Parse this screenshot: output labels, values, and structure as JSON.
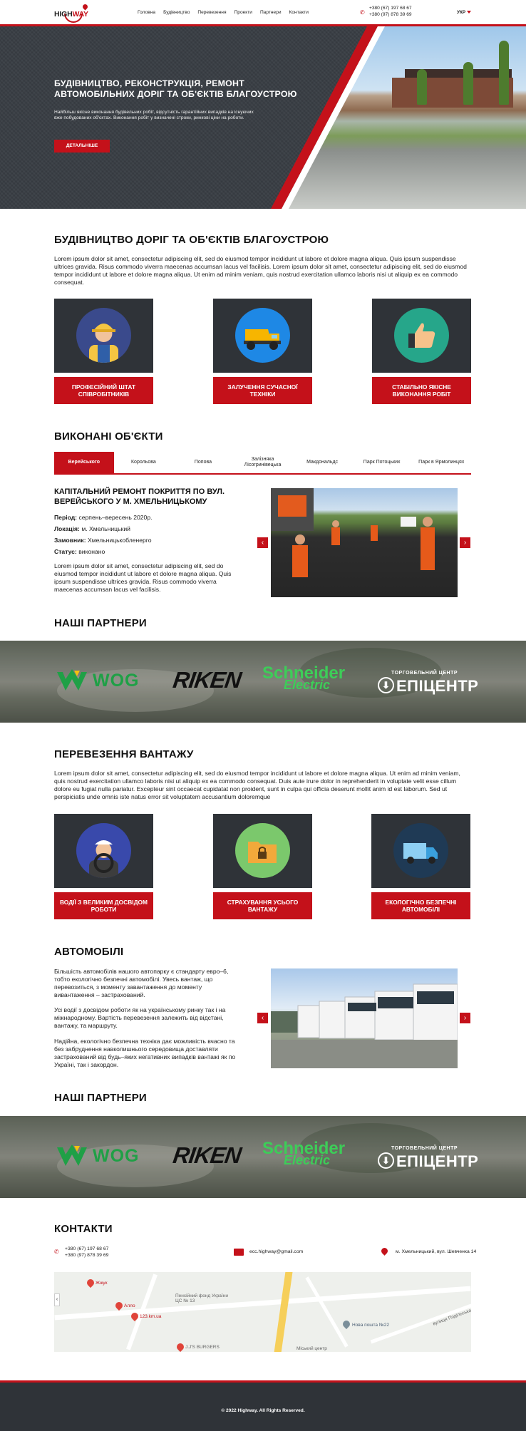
{
  "header": {
    "logo_text_a": "HIGH",
    "logo_text_b": "WAY",
    "nav": [
      "Головна",
      "Будівництво",
      "Перевезення",
      "Проекти",
      "Партнери",
      "Контакти"
    ],
    "phones": [
      "+380 (67) 197 68 67",
      "+380 (97) 878 39 69"
    ],
    "lang": "УКР",
    "brand_color": "#c4111a"
  },
  "hero": {
    "title": "БУДІВНИЦТВО, РЕКОНСТРУКЦІЯ, РЕМОНТ АВТОМОБІЛЬНИХ ДОРІГ ТА ОБ'ЄКТІВ БЛАГОУСТРОЮ",
    "subtitle": "Найбільш якісне виконання будівельних робіт, відсутність гарантійних випадків на існуючих вже побудованих об'єктах. Виконання робіт у визначені строки, ринкові ціни на роботи.",
    "button": "ДЕТАЛЬНІШЕ"
  },
  "construction": {
    "title": "БУДІВНИЦТВО ДОРІГ ТА ОБ'ЄКТІВ БЛАГОУСТРОЮ",
    "text": "Lorem ipsum dolor sit amet, consectetur adipiscing elit, sed do eiusmod tempor incididunt ut labore et dolore magna aliqua. Quis ipsum suspendisse ultrices gravida. Risus commodo viverra maecenas accumsan lacus vel facilisis. Lorem ipsum dolor sit amet, consectetur adipiscing elit, sed do eiusmod tempor incididunt ut labore et dolore magna aliqua. Ut enim ad minim veniam, quis nostrud exercitation ullamco laboris nisi ut aliquip ex ea commodo consequat.",
    "cards": [
      {
        "label": "ПРОФЕСІЙНИЙ ШТАТ СПІВРОБІТНИКІВ",
        "icon": "worker-icon"
      },
      {
        "label": "ЗАЛУЧЕННЯ СУЧАСНОЇ ТЕХНІКИ",
        "icon": "dump-truck-icon"
      },
      {
        "label": "СТАБІЛЬНО ЯКІСНЕ ВИКОНАННЯ РОБІТ",
        "icon": "thumbs-up-icon"
      }
    ]
  },
  "projects": {
    "title": "ВИКОНАНІ ОБ'ЄКТИ",
    "tabs": [
      "Верейського",
      "Корольова",
      "Попова",
      "Залізняка Лісогринівецька",
      "Макдональдс",
      "Парк Потоцьких",
      "Парк в Ярмолинцях"
    ],
    "active_tab": "Верейського",
    "item": {
      "title": "КАПІТАЛЬНИЙ РЕМОНТ ПОКРИТТЯ ПО ВУЛ. ВЕРЕЙСЬКОГО У М. ХМЕЛЬНИЦЬКОМУ",
      "period_label": "Період:",
      "period": "серпень–вересень 2020р.",
      "location_label": "Локація:",
      "location": "м. Хмельницький",
      "client_label": "Замовник:",
      "client": "Хмельницькобленерго",
      "status_label": "Статус:",
      "status": "виконано",
      "text": "Lorem ipsum dolor sit amet, consectetur adipiscing elit, sed do eiusmod tempor incididunt ut labore et dolore magna aliqua. Quis ipsum suspendisse ultrices gravida. Risus commodo viverra maecenas accumsan lacus vel facilisis."
    }
  },
  "partners": {
    "title": "НАШІ ПАРТНЕРИ",
    "logos": {
      "wog": "WOG",
      "riken": "RIKEN",
      "schneider_a": "Schneider",
      "schneider_b": "Electric",
      "epic_top": "ТОРГОВЕЛЬНИЙ ЦЕНТР",
      "epic_main": "ЕПІЦЕНТР"
    }
  },
  "transport": {
    "title": "ПЕРЕВЕЗЕННЯ ВАНТАЖУ",
    "text": "Lorem ipsum dolor sit amet, consectetur adipiscing elit, sed do eiusmod tempor incididunt ut labore et dolore magna aliqua. Ut enim ad minim veniam, quis nostrud exercitation ullamco laboris nisi ut aliquip ex ea commodo consequat. Duis aute irure dolor in reprehenderit in voluptate velit esse cillum dolore eu fugiat nulla pariatur. Excepteur sint occaecat cupidatat non proident, sunt in culpa qui officia deserunt mollit anim id est laborum. Sed ut perspiciatis unde omnis iste natus error sit voluptatem accusantium doloremque",
    "cards": [
      {
        "label": "ВОДІЇ З ВЕЛИКИМ ДОСВІДОМ РОБОТИ",
        "icon": "driver-icon"
      },
      {
        "label": "СТРАХУВАННЯ УСЬОГО ВАНТАЖУ",
        "icon": "insurance-folder-icon"
      },
      {
        "label": "ЕКОЛОГІЧНО БЕЗПЕЧНІ АВТОМОБІЛІ",
        "icon": "truck-icon"
      }
    ]
  },
  "cars": {
    "title": "АВТОМОБІЛІ",
    "p1": "Більшість автомобілів нашого автопарку є стандарту евро–6, тобто екологічно безпечні автомобілі. Увесь вантаж, що перевозиться, з моменту завантаження до моменту вивантаження – застрахований.",
    "p2": "Усі водії з досвідом роботи як на українському ринку так і на міжнародному. Вартість перевезення залежить від відстані, вантажу, та маршруту.",
    "p3": "Надійна, екологічно безпечна техніка дає можливість вчасно та без забруднення навколишнього середовища доставляти застрахований від будь–яких негативних випадків вантажі як по Україні, так і закордон."
  },
  "contacts": {
    "title": "КОНТАКТИ",
    "phones": [
      "+380 (67) 197 68 67",
      "+380 (97) 878 39 69"
    ],
    "email": "ecc.highway@gmail.com",
    "address": "м. Хмельницький, вул. Шевченка 14",
    "map_labels": [
      "Жжук",
      "Алло",
      "123.km.ua",
      "Пенсійний фонд України ЦС № 13",
      "Нова пошта №22",
      "J.J'S BURGERS",
      "Міський центр",
      "вулиця Подільська"
    ]
  },
  "footer": {
    "copyright": "© 2022 Highway. All Rights Reserved."
  }
}
